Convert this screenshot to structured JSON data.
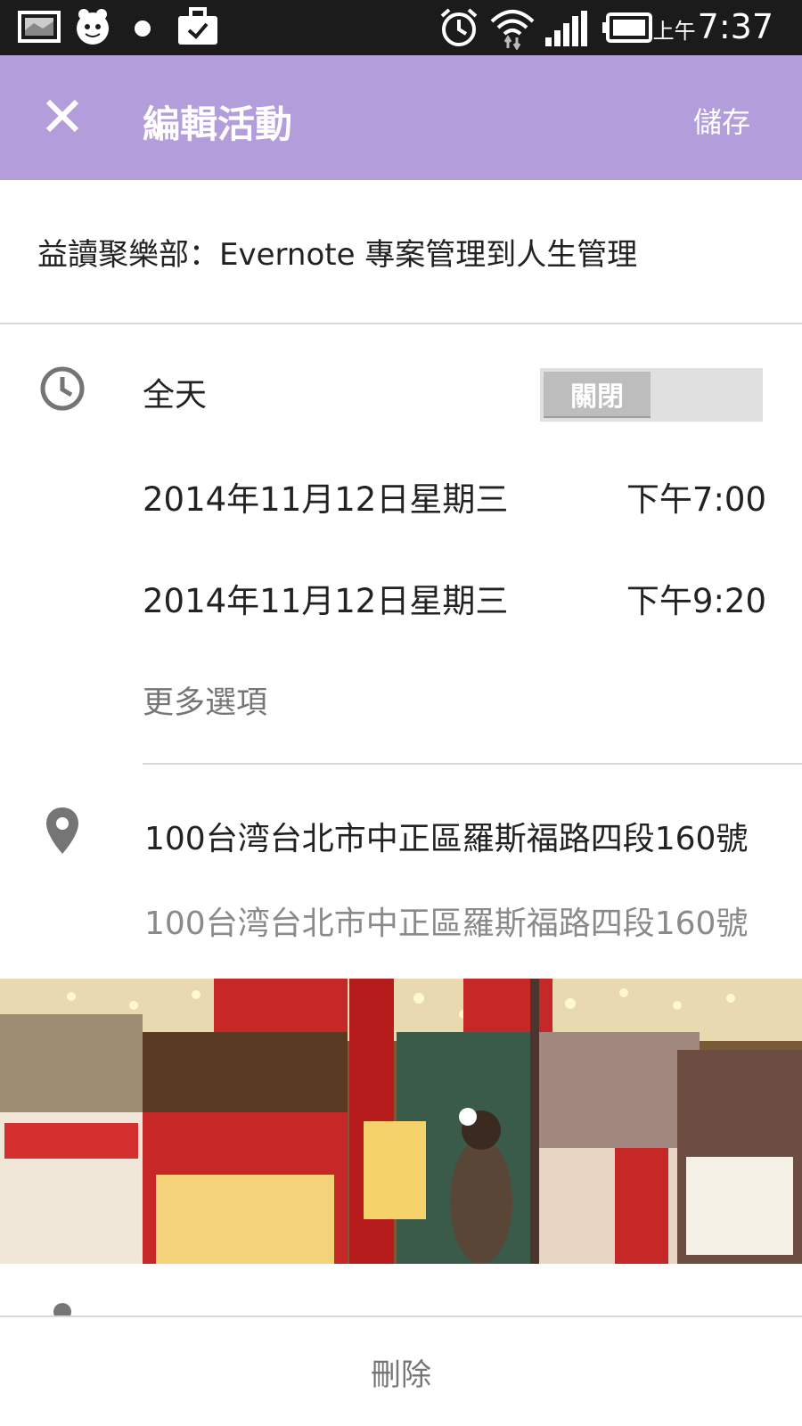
{
  "status_bar": {
    "ampm": "上午",
    "time": "7:37",
    "icons": [
      "image-icon",
      "mascot-icon",
      "dot-icon",
      "briefcase-check-icon",
      "alarm-icon",
      "wifi-icon",
      "signal-icon",
      "battery-icon"
    ]
  },
  "app_bar": {
    "close_icon": "close-icon",
    "title": "編輯活動",
    "save_label": "儲存",
    "color": "#b39ddb"
  },
  "event": {
    "title": "益讀聚樂部：Evernote 專案管理到人生管理"
  },
  "time_section": {
    "icon": "clock-icon",
    "all_day_label": "全天",
    "toggle_state": "關閉",
    "start_date": "2014年11月12日星期三",
    "start_time": "下午7:00",
    "end_date": "2014年11月12日星期三",
    "end_time": "下午9:20",
    "more_options": "更多選項"
  },
  "location_section": {
    "icon": "location-pin-icon",
    "location": "100台湾台北市中正區羅斯福路四段160號",
    "location_secondary": "100台湾台北市中正區羅斯福路四段160號"
  },
  "photo": {
    "description_icon": "bookstore-photo"
  },
  "bottom": {
    "delete_label": "刪除"
  }
}
